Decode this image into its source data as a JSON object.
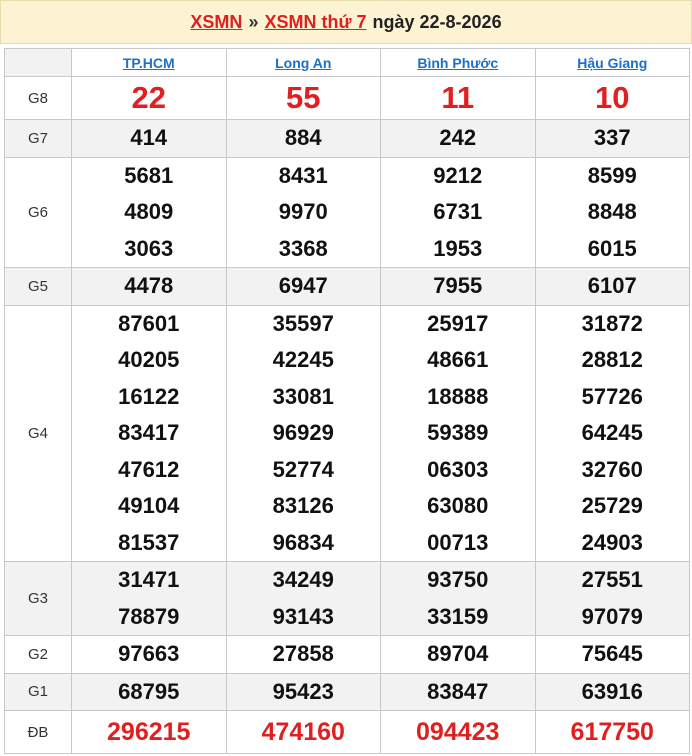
{
  "header": {
    "link1": "XSMN",
    "separator": "»",
    "link2": "XSMN thứ 7",
    "date": "ngày 22-8-2026"
  },
  "provinces": [
    "TP.HCM",
    "Long An",
    "Bình Phước",
    "Hậu Giang"
  ],
  "rows": [
    {
      "label": "G8",
      "style": "big",
      "shade": false,
      "values": [
        [
          "22"
        ],
        [
          "55"
        ],
        [
          "11"
        ],
        [
          "10"
        ]
      ]
    },
    {
      "label": "G7",
      "style": "num",
      "shade": true,
      "values": [
        [
          "414"
        ],
        [
          "884"
        ],
        [
          "242"
        ],
        [
          "337"
        ]
      ]
    },
    {
      "label": "G6",
      "style": "num",
      "shade": false,
      "values": [
        [
          "5681",
          "4809",
          "3063"
        ],
        [
          "8431",
          "9970",
          "3368"
        ],
        [
          "9212",
          "6731",
          "1953"
        ],
        [
          "8599",
          "8848",
          "6015"
        ]
      ]
    },
    {
      "label": "G5",
      "style": "num",
      "shade": true,
      "values": [
        [
          "4478"
        ],
        [
          "6947"
        ],
        [
          "7955"
        ],
        [
          "6107"
        ]
      ]
    },
    {
      "label": "G4",
      "style": "num",
      "shade": false,
      "values": [
        [
          "87601",
          "40205",
          "16122",
          "83417",
          "47612",
          "49104",
          "81537"
        ],
        [
          "35597",
          "42245",
          "33081",
          "96929",
          "52774",
          "83126",
          "96834"
        ],
        [
          "25917",
          "48661",
          "18888",
          "59389",
          "06303",
          "63080",
          "00713"
        ],
        [
          "31872",
          "28812",
          "57726",
          "64245",
          "32760",
          "25729",
          "24903"
        ]
      ]
    },
    {
      "label": "G3",
      "style": "num",
      "shade": true,
      "values": [
        [
          "31471",
          "78879"
        ],
        [
          "34249",
          "93143"
        ],
        [
          "93750",
          "33159"
        ],
        [
          "27551",
          "97079"
        ]
      ]
    },
    {
      "label": "G2",
      "style": "num",
      "shade": false,
      "values": [
        [
          "97663"
        ],
        [
          "27858"
        ],
        [
          "89704"
        ],
        [
          "75645"
        ]
      ]
    },
    {
      "label": "G1",
      "style": "num",
      "shade": true,
      "values": [
        [
          "68795"
        ],
        [
          "95423"
        ],
        [
          "83847"
        ],
        [
          "63916"
        ]
      ]
    },
    {
      "label": "ĐB",
      "style": "db",
      "shade": false,
      "values": [
        [
          "296215"
        ],
        [
          "474160"
        ],
        [
          "094423"
        ],
        [
          "617750"
        ]
      ]
    }
  ],
  "colors": {
    "header_bg": "#fcf3d3",
    "link_red": "#e02020",
    "province_blue": "#1e6fc8",
    "row_shade": "#f2f2f2"
  }
}
